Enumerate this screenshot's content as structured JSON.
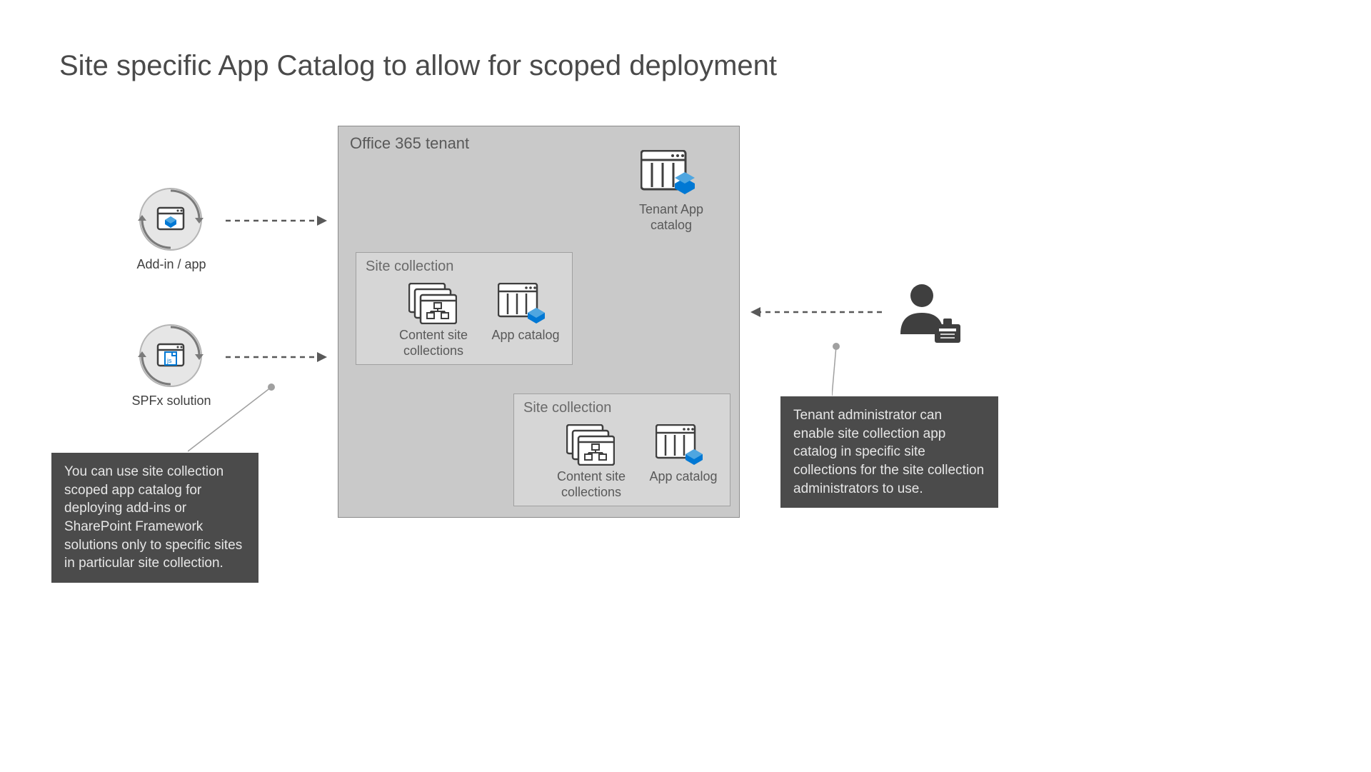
{
  "title": "Site specific App Catalog to allow for scoped deployment",
  "tenant": {
    "label": "Office 365 tenant"
  },
  "tenantApp": {
    "label": "Tenant App\ncatalog"
  },
  "site1": {
    "label": "Site collection",
    "content_label": "Content site\ncollections",
    "app_label": "App catalog"
  },
  "site2": {
    "label": "Site collection",
    "content_label": "Content site\ncollections",
    "app_label": "App catalog"
  },
  "left": {
    "addin_label": "Add-in / app",
    "spfx_label": "SPFx solution"
  },
  "callout_left": "You can use site collection scoped app catalog for deploying add-ins or SharePoint Framework solutions only to specific sites in particular site collection.",
  "callout_right": "Tenant administrator can enable site collection app catalog in specific site collections for the site collection administrators to use."
}
